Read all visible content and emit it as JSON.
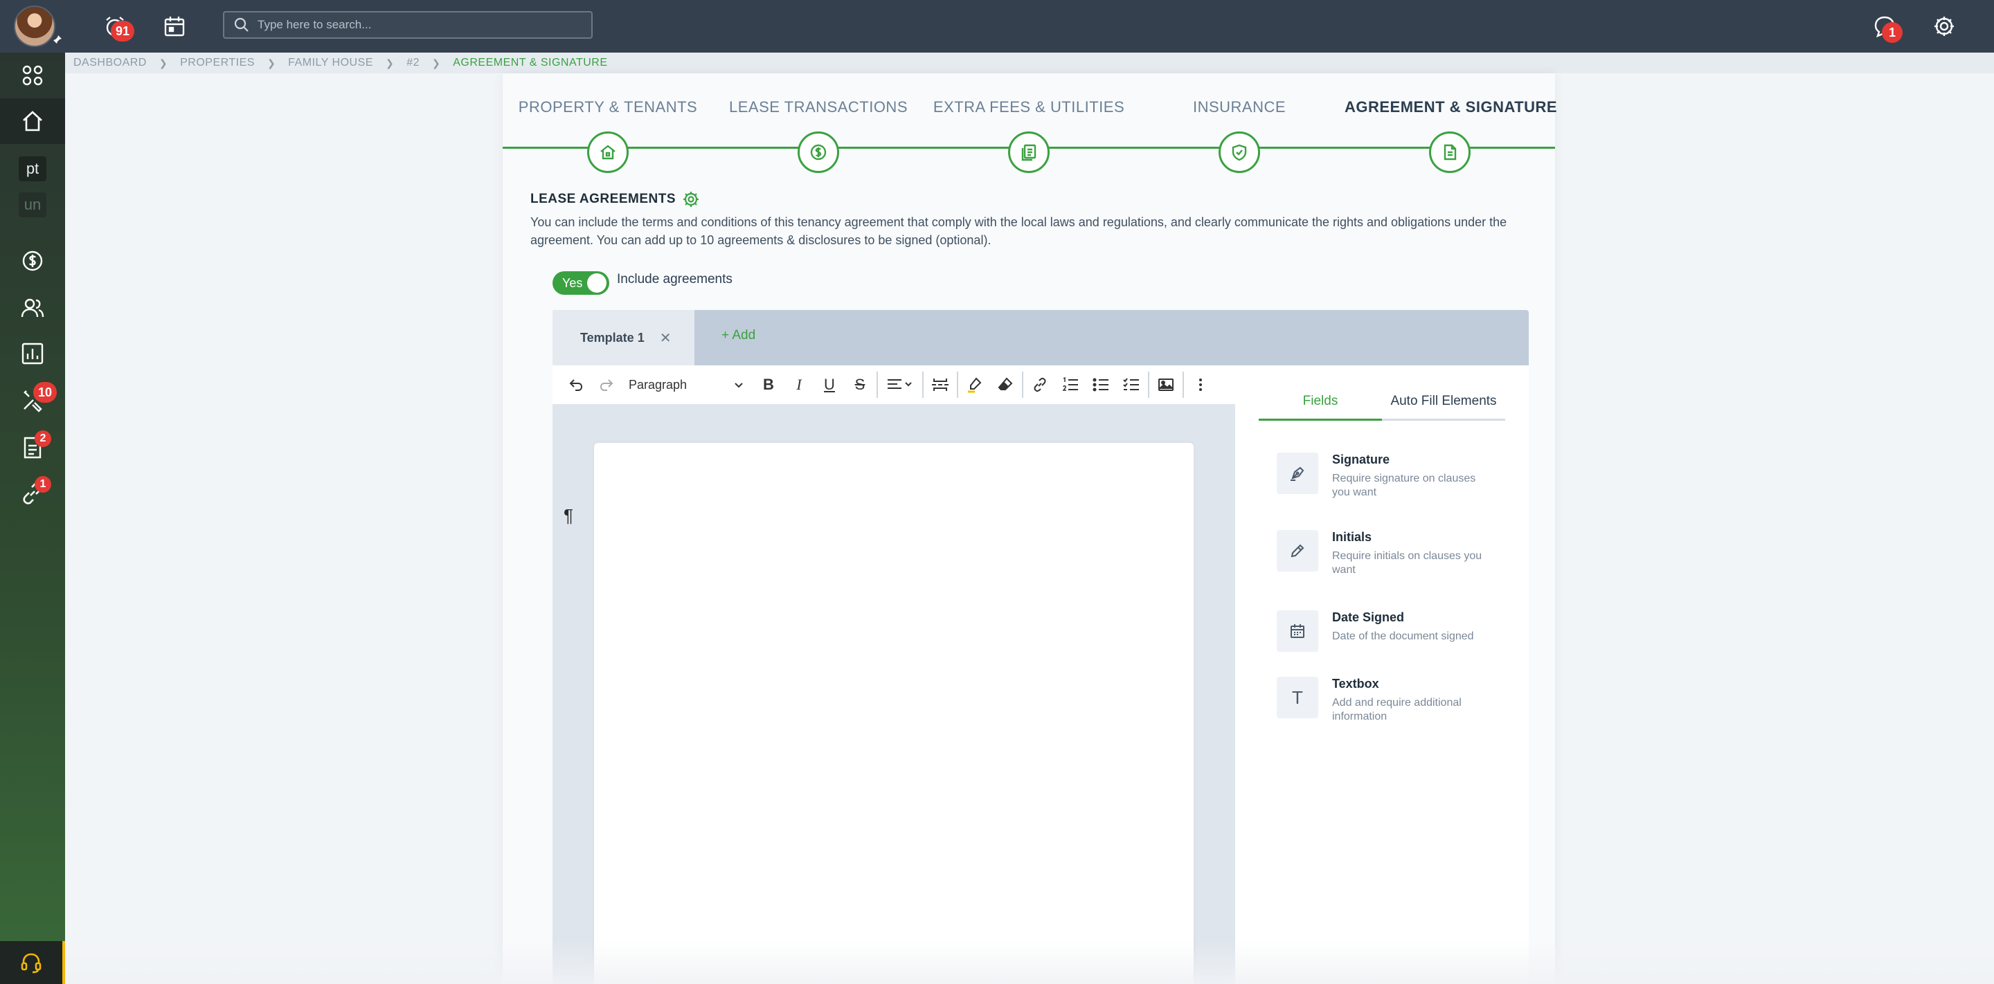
{
  "topbar": {
    "search_placeholder": "Type here to search...",
    "alerts_badge": "91",
    "messages_badge": "1"
  },
  "sidebar": {
    "items": [
      {
        "icon": "apps-grid-icon"
      },
      {
        "icon": "home-icon",
        "active": true
      },
      {
        "label": "pt"
      },
      {
        "label": "un"
      },
      {
        "icon": "dollar-circle-icon"
      },
      {
        "icon": "users-icon"
      },
      {
        "icon": "chart-icon"
      },
      {
        "icon": "tools-icon",
        "badge": "10"
      },
      {
        "icon": "document-icon",
        "badge": "2"
      },
      {
        "icon": "link-icon",
        "badge": "1"
      }
    ]
  },
  "breadcrumb": [
    "DASHBOARD",
    "PROPERTIES",
    "FAMILY HOUSE",
    "#2",
    "AGREEMENT & SIGNATURE"
  ],
  "steps": [
    {
      "label": "PROPERTY & TENANTS",
      "icon": "house-icon"
    },
    {
      "label": "LEASE TRANSACTIONS",
      "icon": "dollar-icon"
    },
    {
      "label": "EXTRA FEES & UTILITIES",
      "icon": "receipts-icon"
    },
    {
      "label": "INSURANCE",
      "icon": "shield-check-icon"
    },
    {
      "label": "AGREEMENT & SIGNATURE",
      "icon": "file-icon",
      "active": true
    }
  ],
  "section": {
    "title": "LEASE AGREEMENTS",
    "description": "You can include the terms and conditions of this tenancy agreement that comply with the local laws and regulations, and clearly communicate the rights and obligations under the agreement. You can add up to 10 agreements & disclosures to be signed (optional)."
  },
  "toggle": {
    "state": "Yes",
    "label": "Include agreements"
  },
  "template_tabs": {
    "tab": "Template 1",
    "add": "+ Add"
  },
  "toolbar": {
    "paragraph": "Paragraph"
  },
  "editor": {
    "pilcrow": "¶"
  },
  "fields_panel": {
    "tabs": [
      "Fields",
      "Auto Fill Elements"
    ],
    "items": [
      {
        "title": "Signature",
        "desc": "Require signature on clauses you want",
        "icon": "pen-nib-icon"
      },
      {
        "title": "Initials",
        "desc": "Require initials on clauses you want",
        "icon": "pencil-icon"
      },
      {
        "title": "Date Signed",
        "desc": "Date of the document signed",
        "icon": "calendar-icon"
      },
      {
        "title": "Textbox",
        "desc": "Add and require additional information",
        "icon": "text-t-icon"
      }
    ]
  },
  "colors": {
    "accent": "#3aa141",
    "topbar": "#34404d",
    "badge": "#e53935"
  }
}
